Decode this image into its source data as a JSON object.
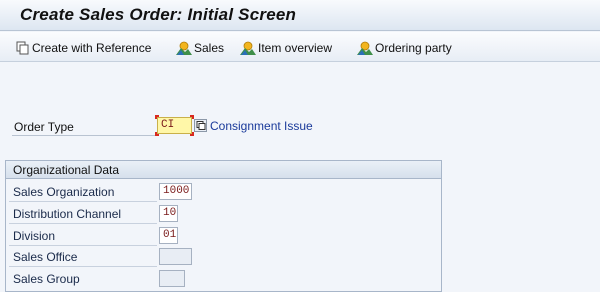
{
  "window": {
    "title": "Create Sales Order: Initial Screen"
  },
  "toolbar": {
    "create_with_reference": "Create with Reference",
    "sales": "Sales",
    "item_overview": "Item overview",
    "ordering_party": "Ordering party"
  },
  "order": {
    "label": "Order Type",
    "value": "CI",
    "description": "Consignment Issue"
  },
  "org": {
    "title": "Organizational Data",
    "fields": [
      {
        "label": "Sales Organization",
        "value": "1000"
      },
      {
        "label": "Distribution Channel",
        "value": "10"
      },
      {
        "label": "Division",
        "value": "01"
      },
      {
        "label": "Sales Office",
        "value": ""
      },
      {
        "label": "Sales Group",
        "value": ""
      }
    ]
  },
  "colors": {
    "required_field": "#fff7a8",
    "link": "#1a3a9a",
    "background": "#f2f5fa"
  }
}
